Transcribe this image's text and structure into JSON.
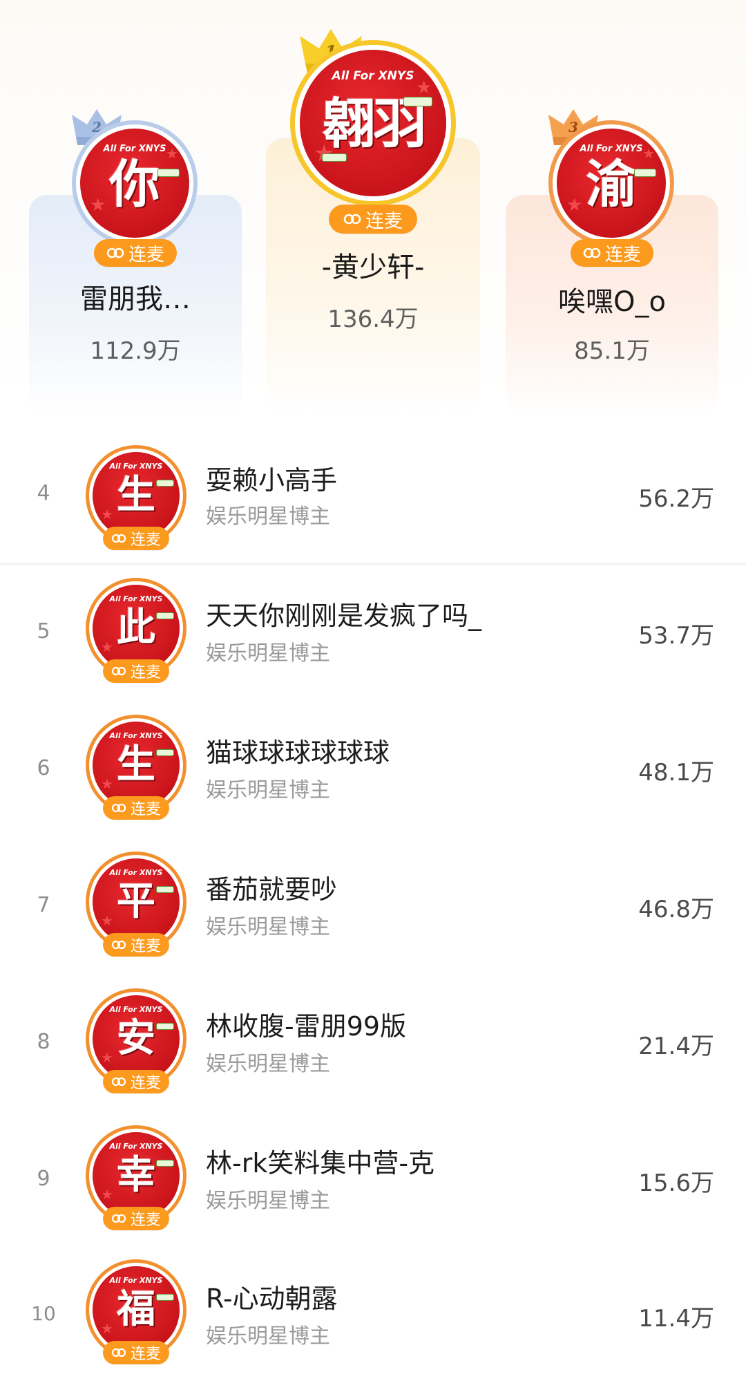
{
  "badge_label": "连麦",
  "top3": [
    {
      "rank": "1",
      "name": "-黄少轩-",
      "score": "136.4万",
      "avatar_char": "翱羽",
      "avatar_top": "All For XNYS"
    },
    {
      "rank": "2",
      "name": "雷朋我…",
      "score": "112.9万",
      "avatar_char": "你",
      "avatar_top": "All For XNYS"
    },
    {
      "rank": "3",
      "name": "唉嘿O_o",
      "score": "85.1万",
      "avatar_char": "渝",
      "avatar_top": "All For XNYS"
    }
  ],
  "list": [
    {
      "rank": "4",
      "name": "耍赖小高手",
      "subtitle": "娱乐明星博主",
      "score": "56.2万",
      "avatar_char": "生"
    },
    {
      "rank": "5",
      "name": "天天你刚刚是发疯了吗_",
      "subtitle": "娱乐明星博主",
      "score": "53.7万",
      "avatar_char": "此"
    },
    {
      "rank": "6",
      "name": "猫球球球球球球",
      "subtitle": "娱乐明星博主",
      "score": "48.1万",
      "avatar_char": "生"
    },
    {
      "rank": "7",
      "name": "番茄就要吵",
      "subtitle": "娱乐明星博主",
      "score": "46.8万",
      "avatar_char": "平"
    },
    {
      "rank": "8",
      "name": "林收腹-雷朋99版",
      "subtitle": "娱乐明星博主",
      "score": "21.4万",
      "avatar_char": "安"
    },
    {
      "rank": "9",
      "name": "林-rk笑料集中营-克",
      "subtitle": "娱乐明星博主",
      "score": "15.6万",
      "avatar_char": "幸"
    },
    {
      "rank": "10",
      "name": "R-心动朝露",
      "subtitle": "娱乐明星博主",
      "score": "11.4万",
      "avatar_char": "福"
    }
  ],
  "avatar_top_small": "All For XNYS",
  "colors": {
    "badge_orange": "#fc9a1e",
    "avatar_red": "#d4181f",
    "ring_gold": "#f6c21b",
    "ring_silver": "#9ab5de",
    "ring_bronze": "#f08d3a",
    "row_ring": "#f2902e"
  },
  "icons": {
    "badge_icon": "link-rings-icon",
    "crown_icon": "crown-icon"
  }
}
